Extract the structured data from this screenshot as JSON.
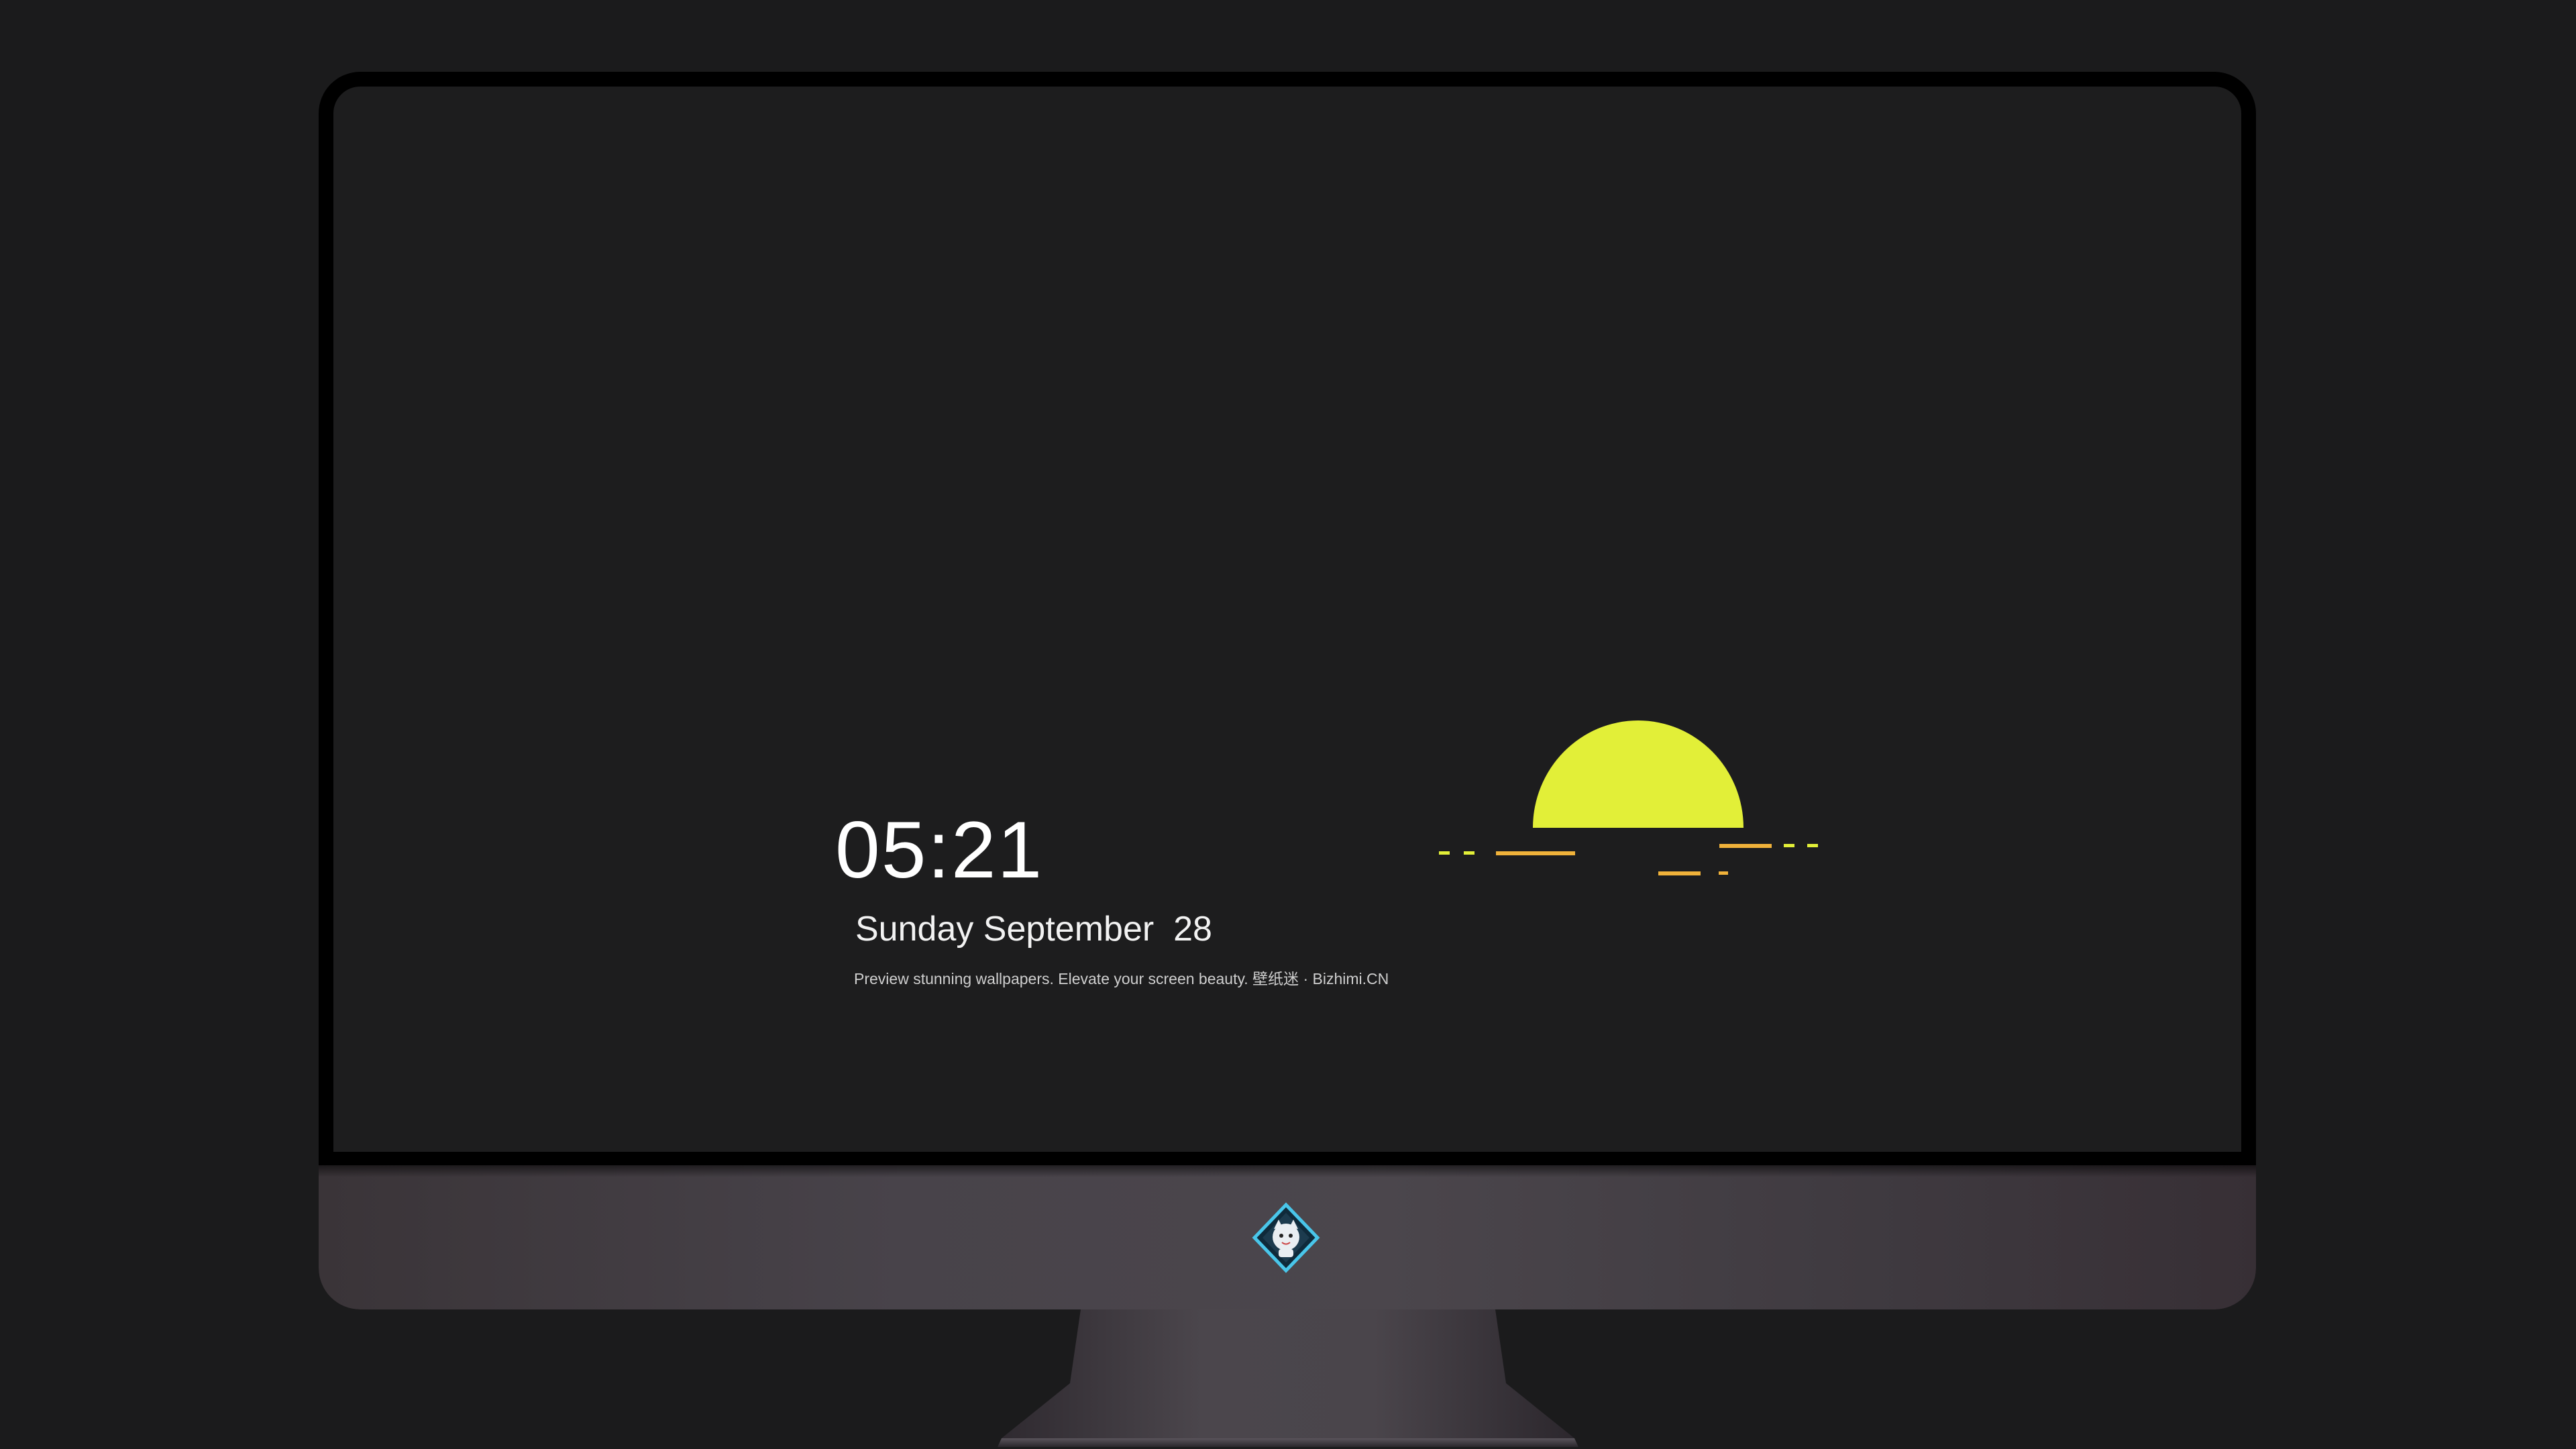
{
  "lock_screen": {
    "time": "05:21",
    "date": "Sunday September  28",
    "tagline": "Preview stunning wallpapers. Elevate your screen beauty. 壁纸迷 · Bizhimi.CN"
  },
  "wallpaper": {
    "sun_color": "#e2ef38",
    "dash_colors": [
      "#e2ef38",
      "#f0b23a"
    ]
  },
  "dock": {
    "apps": [
      {
        "name": "messages-icon"
      },
      {
        "name": "weather-icon"
      },
      {
        "name": "clock-icon"
      },
      {
        "name": "preview-icon"
      },
      {
        "name": "clips-icon"
      },
      {
        "name": "notes-icon"
      },
      {
        "name": "photo-booth-icon"
      },
      {
        "name": "itunes-icon"
      },
      {
        "name": "app-store-icon"
      },
      {
        "name": "camera-icon"
      }
    ]
  },
  "colors": {
    "background": "#1b1b1c",
    "screen": "#1d1d1e",
    "dock": "#2b2b2d"
  }
}
